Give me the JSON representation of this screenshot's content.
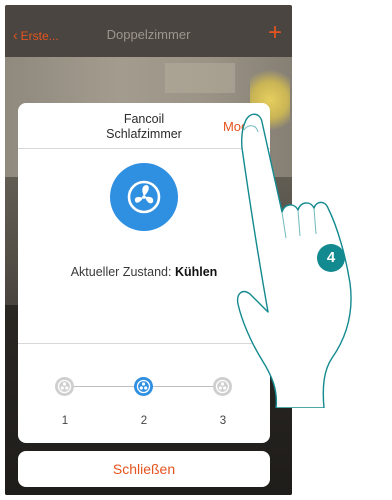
{
  "topbar": {
    "back_label": "Erste...",
    "title": "Doppelzimmer",
    "add_symbol": "+"
  },
  "dialog": {
    "title_line1": "Fancoil",
    "title_line2": "Schlafzimmer",
    "mode_label": "Modus",
    "status_prefix": "Aktueller Zustand:",
    "status_value": "Kühlen",
    "speeds": [
      {
        "label": "1",
        "active": false
      },
      {
        "label": "2",
        "active": true
      },
      {
        "label": "3",
        "active": false
      }
    ],
    "close_label": "Schließen"
  },
  "annotation": {
    "step_number": "4"
  },
  "icons": {
    "back": "chevron-left-icon",
    "add": "plus-icon",
    "fan": "fan-icon",
    "pointer": "hand-pointer-icon"
  },
  "colors": {
    "accent": "#e5541e",
    "fan_blue": "#2f8fe0",
    "step_badge": "#138a8f",
    "topbar": "#4a4540"
  }
}
